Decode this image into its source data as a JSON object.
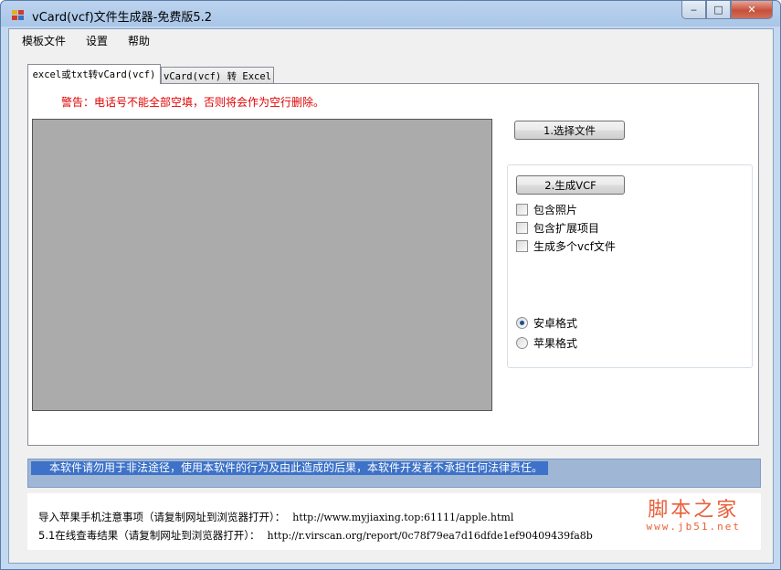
{
  "window": {
    "title": "vCard(vcf)文件生成器-免费版5.2",
    "controls": {
      "minimize": "‒",
      "maximize": "□",
      "close": "✕"
    }
  },
  "menu": {
    "items": [
      {
        "label": "模板文件"
      },
      {
        "label": "设置"
      },
      {
        "label": "帮助"
      }
    ]
  },
  "tabs": [
    {
      "label": "excel或txt转vCard(vcf)",
      "active": true
    },
    {
      "label": "vCard(vcf) 转 Excel",
      "active": false
    }
  ],
  "main": {
    "warning": "警告：电话号不能全部空填，否则将会作为空行删除。",
    "select_file_button": "1.选择文件",
    "generate_button": "2.生成VCF",
    "checkboxes": [
      {
        "label": "包含照片",
        "checked": false
      },
      {
        "label": "包含扩展项目",
        "checked": false
      },
      {
        "label": "生成多个vcf文件",
        "checked": false
      }
    ],
    "radios": [
      {
        "label": "安卓格式",
        "checked": true
      },
      {
        "label": "苹果格式",
        "checked": false
      }
    ]
  },
  "footer": {
    "disclaimer": "本软件请勿用于非法途径，使用本软件的行为及由此造成的后果，本软件开发者不承担任何法律责任。",
    "apple_note_label": "导入苹果手机注意事项（请复制网址到浏览器打开）：",
    "apple_note_url": "http://www.myjiaxing.top:61111/apple.html",
    "virus_scan_label": "5.1在线查毒结果（请复制网址到浏览器打开）：",
    "virus_scan_url": "http://r.virscan.org/report/0c78f79ea7d16dfde1ef90409439fa8b"
  },
  "watermark": {
    "main": "脚本之家",
    "sub": "www.jb51.net"
  },
  "colors": {
    "warning": "#e00000",
    "preview_bg": "#ababab",
    "disclaimer_highlight": "#3d72c8",
    "disclaimer_bar": "#9fb6d4",
    "watermark": "#e8603a"
  }
}
